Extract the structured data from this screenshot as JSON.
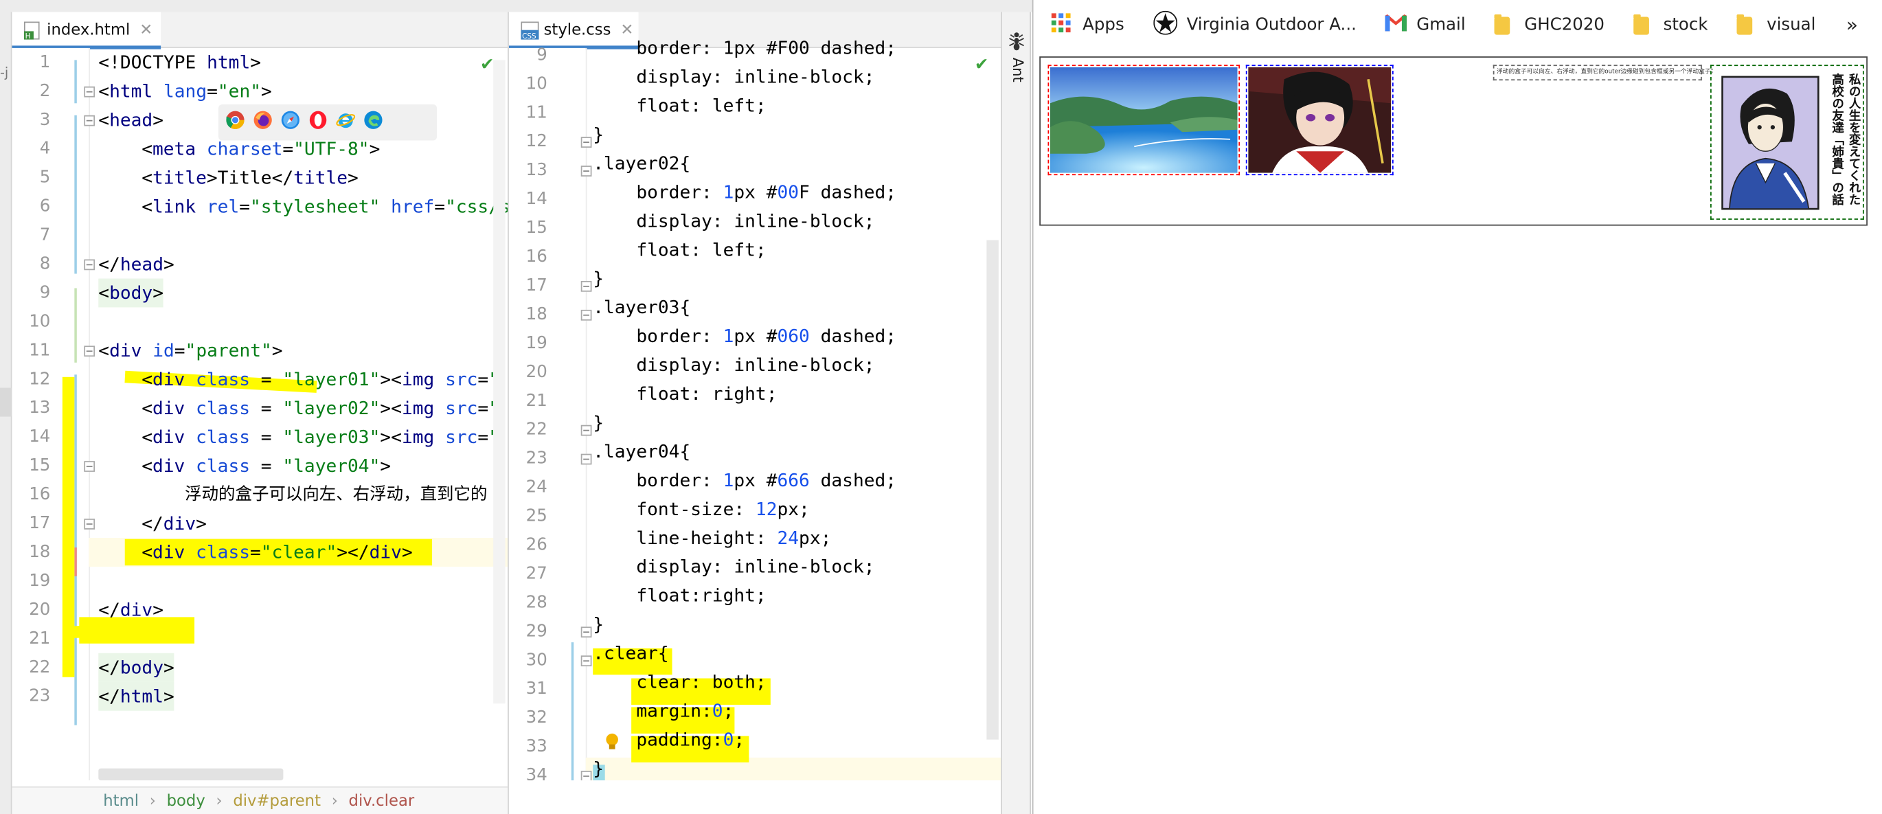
{
  "editor": {
    "left_gutter_label": "-j",
    "tabs": [
      {
        "label": "index.html",
        "type": "html"
      },
      {
        "label": "style.css",
        "type": "css"
      }
    ],
    "html_lines": [
      {
        "n": "1"
      },
      {
        "n": "2"
      },
      {
        "n": "3"
      },
      {
        "n": "4"
      },
      {
        "n": "5"
      },
      {
        "n": "6"
      },
      {
        "n": "7"
      },
      {
        "n": "8"
      },
      {
        "n": "9"
      },
      {
        "n": "10"
      },
      {
        "n": "11"
      },
      {
        "n": "12"
      },
      {
        "n": "13"
      },
      {
        "n": "14"
      },
      {
        "n": "15"
      },
      {
        "n": "16"
      },
      {
        "n": "17"
      },
      {
        "n": "18"
      },
      {
        "n": "19"
      },
      {
        "n": "20"
      },
      {
        "n": "21"
      },
      {
        "n": "22"
      },
      {
        "n": "23"
      }
    ],
    "html_code": {
      "l1": [
        "<!DOCTYPE ",
        "html",
        ">"
      ],
      "l2": [
        "<",
        "html ",
        "lang",
        "=",
        "\"en\"",
        ">"
      ],
      "l3": [
        "<",
        "head",
        ">"
      ],
      "l4": [
        "<",
        "meta ",
        "charset",
        "=",
        "\"UTF-8\"",
        ">"
      ],
      "l5": [
        "<",
        "title",
        ">",
        "Title",
        "</",
        "title",
        ">"
      ],
      "l6": [
        "<",
        "link ",
        "rel",
        "=",
        "\"stylesheet\" ",
        "href",
        "=",
        "\"css/s"
      ],
      "l8": [
        "</",
        "head",
        ">"
      ],
      "l9": [
        "<",
        "body",
        ">"
      ],
      "l11": [
        "<",
        "div ",
        "id",
        "=",
        "\"parent\"",
        ">"
      ],
      "l12": [
        "<",
        "div ",
        "class ",
        "= ",
        "\"layer01\"",
        "><",
        "img ",
        "src",
        "=",
        "\""
      ],
      "l13": [
        "<",
        "div ",
        "class ",
        "= ",
        "\"layer02\"",
        "><",
        "img ",
        "src",
        "=",
        "\""
      ],
      "l14": [
        "<",
        "div ",
        "class ",
        "= ",
        "\"layer03\"",
        "><",
        "img ",
        "src",
        "=",
        "\""
      ],
      "l15": [
        "<",
        "div ",
        "class ",
        "= ",
        "\"layer04\"",
        ">"
      ],
      "l16": "浮动的盒子可以向左、右浮动，直到它的",
      "l17": [
        "</",
        "div",
        ">"
      ],
      "l18": [
        "<",
        "div ",
        "class",
        "=",
        "\"clear\"",
        "></",
        "div",
        ">"
      ],
      "l20": [
        "</",
        "div",
        ">"
      ],
      "l22": [
        "</",
        "body",
        ">"
      ],
      "l23": [
        "</",
        "html",
        ">"
      ]
    },
    "css_lines": [
      {
        "n": "9"
      },
      {
        "n": "10"
      },
      {
        "n": "11"
      },
      {
        "n": "12"
      },
      {
        "n": "13"
      },
      {
        "n": "14"
      },
      {
        "n": "15"
      },
      {
        "n": "16"
      },
      {
        "n": "17"
      },
      {
        "n": "18"
      },
      {
        "n": "19"
      },
      {
        "n": "20"
      },
      {
        "n": "21"
      },
      {
        "n": "22"
      },
      {
        "n": "23"
      },
      {
        "n": "24"
      },
      {
        "n": "25"
      },
      {
        "n": "26"
      },
      {
        "n": "27"
      },
      {
        "n": "28"
      },
      {
        "n": "29"
      },
      {
        "n": "30"
      },
      {
        "n": "31"
      },
      {
        "n": "32"
      },
      {
        "n": "33"
      },
      {
        "n": "34"
      }
    ],
    "css_code": {
      "c9": "    border: 1px #F00 dashed;",
      "c10": "    display: inline-block;",
      "c11": "    float: left;",
      "c12": "}",
      "c13": ".layer02{",
      "c14": [
        "    border: ",
        "1",
        "px #",
        "00",
        "F dashed;"
      ],
      "c15": "    display: inline-block;",
      "c16": "    float: left;",
      "c17": "}",
      "c18": ".layer03{",
      "c19": [
        "    border: ",
        "1",
        "px #",
        "060",
        " dashed;"
      ],
      "c20": "    display: inline-block;",
      "c21": "    float: right;",
      "c22": "}",
      "c23": ".layer04{",
      "c24": [
        "    border: ",
        "1",
        "px #",
        "666",
        " dashed;"
      ],
      "c25": [
        "    font-size: ",
        "12",
        "px;"
      ],
      "c26": [
        "    line-height: ",
        "24",
        "px;"
      ],
      "c27": "    display: inline-block;",
      "c28": "    float:right;",
      "c29": "}",
      "c30": ".clear{",
      "c31": "    clear: both;",
      "c32": [
        "    margin:",
        "0",
        ";"
      ],
      "c33": [
        "    padding:",
        "0",
        ";"
      ],
      "c34": "}"
    },
    "breadcrumb": [
      "html",
      "body",
      "div#parent",
      "div.clear"
    ],
    "ant_label": "Ant"
  },
  "browser": {
    "bookmarks": [
      {
        "label": "Apps",
        "icon": "apps-grid-icon"
      },
      {
        "label": "Virginia Outdoor A...",
        "icon": "virginia-outdoor-icon"
      },
      {
        "label": "Gmail",
        "icon": "gmail-icon"
      },
      {
        "label": "GHC2020",
        "icon": "folder-icon"
      },
      {
        "label": "stock",
        "icon": "folder-icon"
      },
      {
        "label": "visual",
        "icon": "folder-icon"
      }
    ],
    "more": "»",
    "layer04_text": "浮动的盒子可以向左、右浮动，直到它的outer边缘碰到包含框或另一个浮动盒子为止",
    "manga_title": "私の人生を変えてくれた高校の友達「姉貴」の話",
    "colors": {
      "layer01": "#FF0000",
      "layer02": "#0000FF",
      "layer03": "#006600",
      "layer04": "#666666",
      "highlight": "#FFFB00"
    }
  }
}
